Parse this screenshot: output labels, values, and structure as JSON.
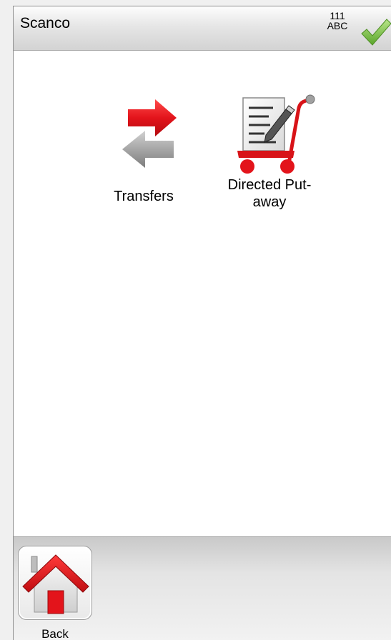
{
  "app": {
    "title": "Scanco"
  },
  "status": {
    "line1": "111",
    "line2": "ABC",
    "icon": "check-icon",
    "accent": "#7cc442"
  },
  "menu": {
    "items": [
      {
        "label": "Transfers",
        "icon": "transfer-arrows-icon"
      },
      {
        "label_line1": "Directed Put-",
        "label_line2": "away",
        "icon": "clipboard-cart-icon"
      }
    ]
  },
  "footer": {
    "back_label": "Back",
    "back_icon": "home-icon"
  },
  "colors": {
    "red": "#e3141b",
    "gray": "#9e9e9e"
  }
}
